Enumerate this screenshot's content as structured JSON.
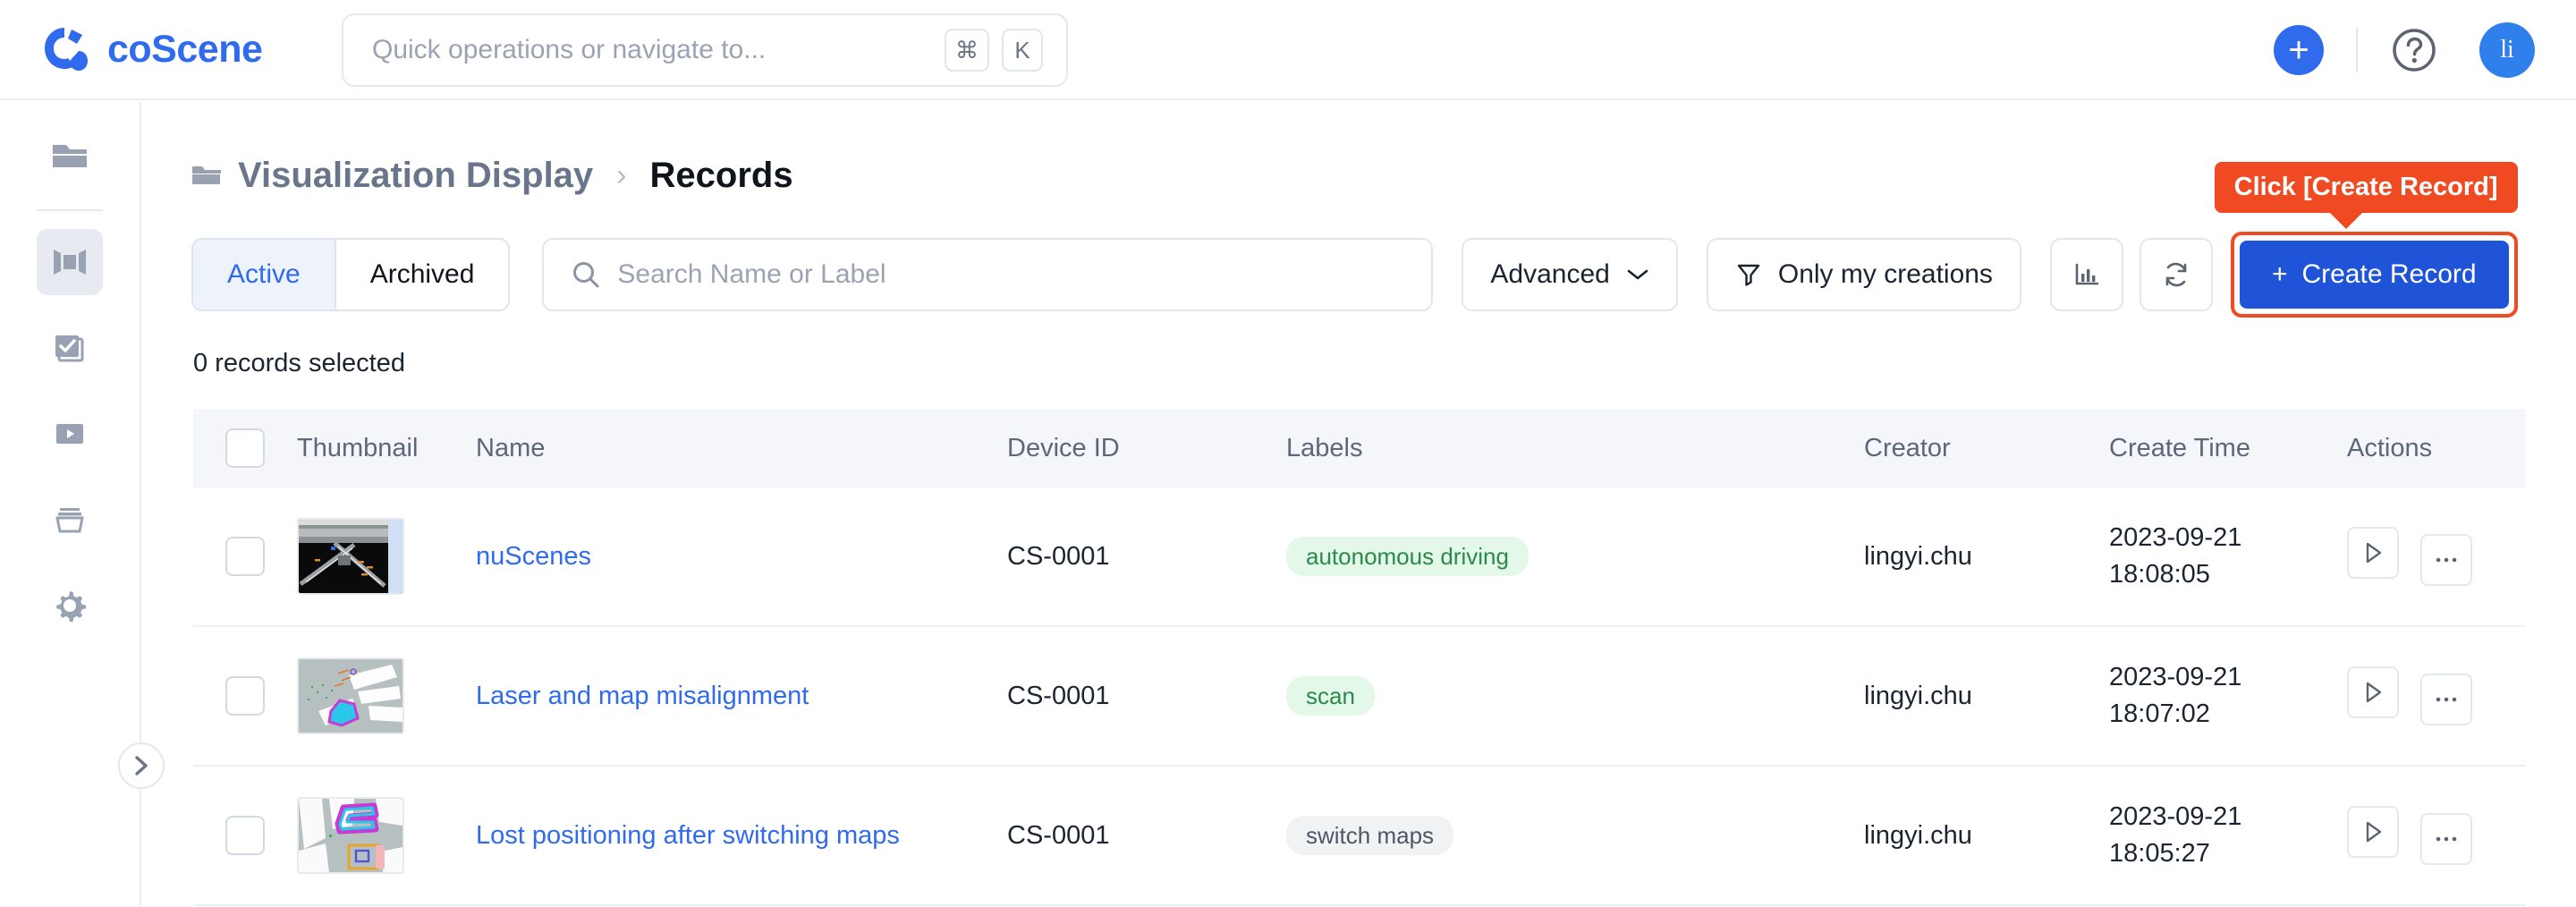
{
  "app": {
    "brand_name": "coScene",
    "logo_color": "#2f6bec"
  },
  "search": {
    "placeholder": "Quick operations or navigate to...",
    "kbd_modifier": "⌘",
    "kbd_key": "K"
  },
  "topbar": {
    "add_label": "+",
    "help_icon": "question-circle-icon",
    "avatar_initials": "li"
  },
  "sidebar": {
    "items": [
      {
        "icon": "folder-icon",
        "name": "projects",
        "active": false
      },
      {
        "icon": "film-strip-icon",
        "name": "visualization",
        "active": true
      },
      {
        "icon": "task-check-icon",
        "name": "tasks",
        "active": false
      },
      {
        "icon": "play-box-icon",
        "name": "playback",
        "active": false
      },
      {
        "icon": "archive-box-icon",
        "name": "archive",
        "active": false
      },
      {
        "icon": "gear-icon",
        "name": "settings",
        "active": false
      }
    ],
    "expand_icon": "chevron-right-icon"
  },
  "breadcrumb": {
    "icon": "folder-icon",
    "parent": "Visualization Display",
    "separator": "›",
    "current": "Records"
  },
  "toolbar": {
    "tabs": [
      {
        "label": "Active",
        "active": true
      },
      {
        "label": "Archived",
        "active": false
      }
    ],
    "search_placeholder": "Search Name or Label",
    "advanced_label": "Advanced",
    "only_my_creations_label": "Only my creations",
    "chart_icon": "bar-chart-icon",
    "refresh_icon": "refresh-icon",
    "create_label": "Create Record",
    "create_plus": "+",
    "callout_text": "Click [Create Record]",
    "callout_color": "#f04a23",
    "create_button_color": "#2054d8"
  },
  "table": {
    "selection_text": "0 records selected",
    "headers": {
      "thumbnail": "Thumbnail",
      "name": "Name",
      "device_id": "Device ID",
      "labels": "Labels",
      "creator": "Creator",
      "create_time": "Create Time",
      "actions": "Actions"
    },
    "rows": [
      {
        "thumbnail": "nuscenes-lidar-intersection",
        "name": "nuScenes",
        "device_id": "CS-0001",
        "label": "autonomous driving",
        "label_style": "green",
        "creator": "lingyi.chu",
        "create_date": "2023-09-21",
        "create_time": "18:08:05"
      },
      {
        "thumbnail": "laser-map-overlay",
        "name": "Laser and map misalignment",
        "device_id": "CS-0001",
        "label": "scan",
        "label_style": "green",
        "creator": "lingyi.chu",
        "create_date": "2023-09-21",
        "create_time": "18:07:02"
      },
      {
        "thumbnail": "switched-map-trace",
        "name": "Lost positioning after switching maps",
        "device_id": "CS-0001",
        "label": "switch maps",
        "label_style": "gray",
        "creator": "lingyi.chu",
        "create_date": "2023-09-21",
        "create_time": "18:05:27"
      }
    ],
    "action_icons": [
      "play-icon",
      "ellipsis-icon"
    ]
  }
}
